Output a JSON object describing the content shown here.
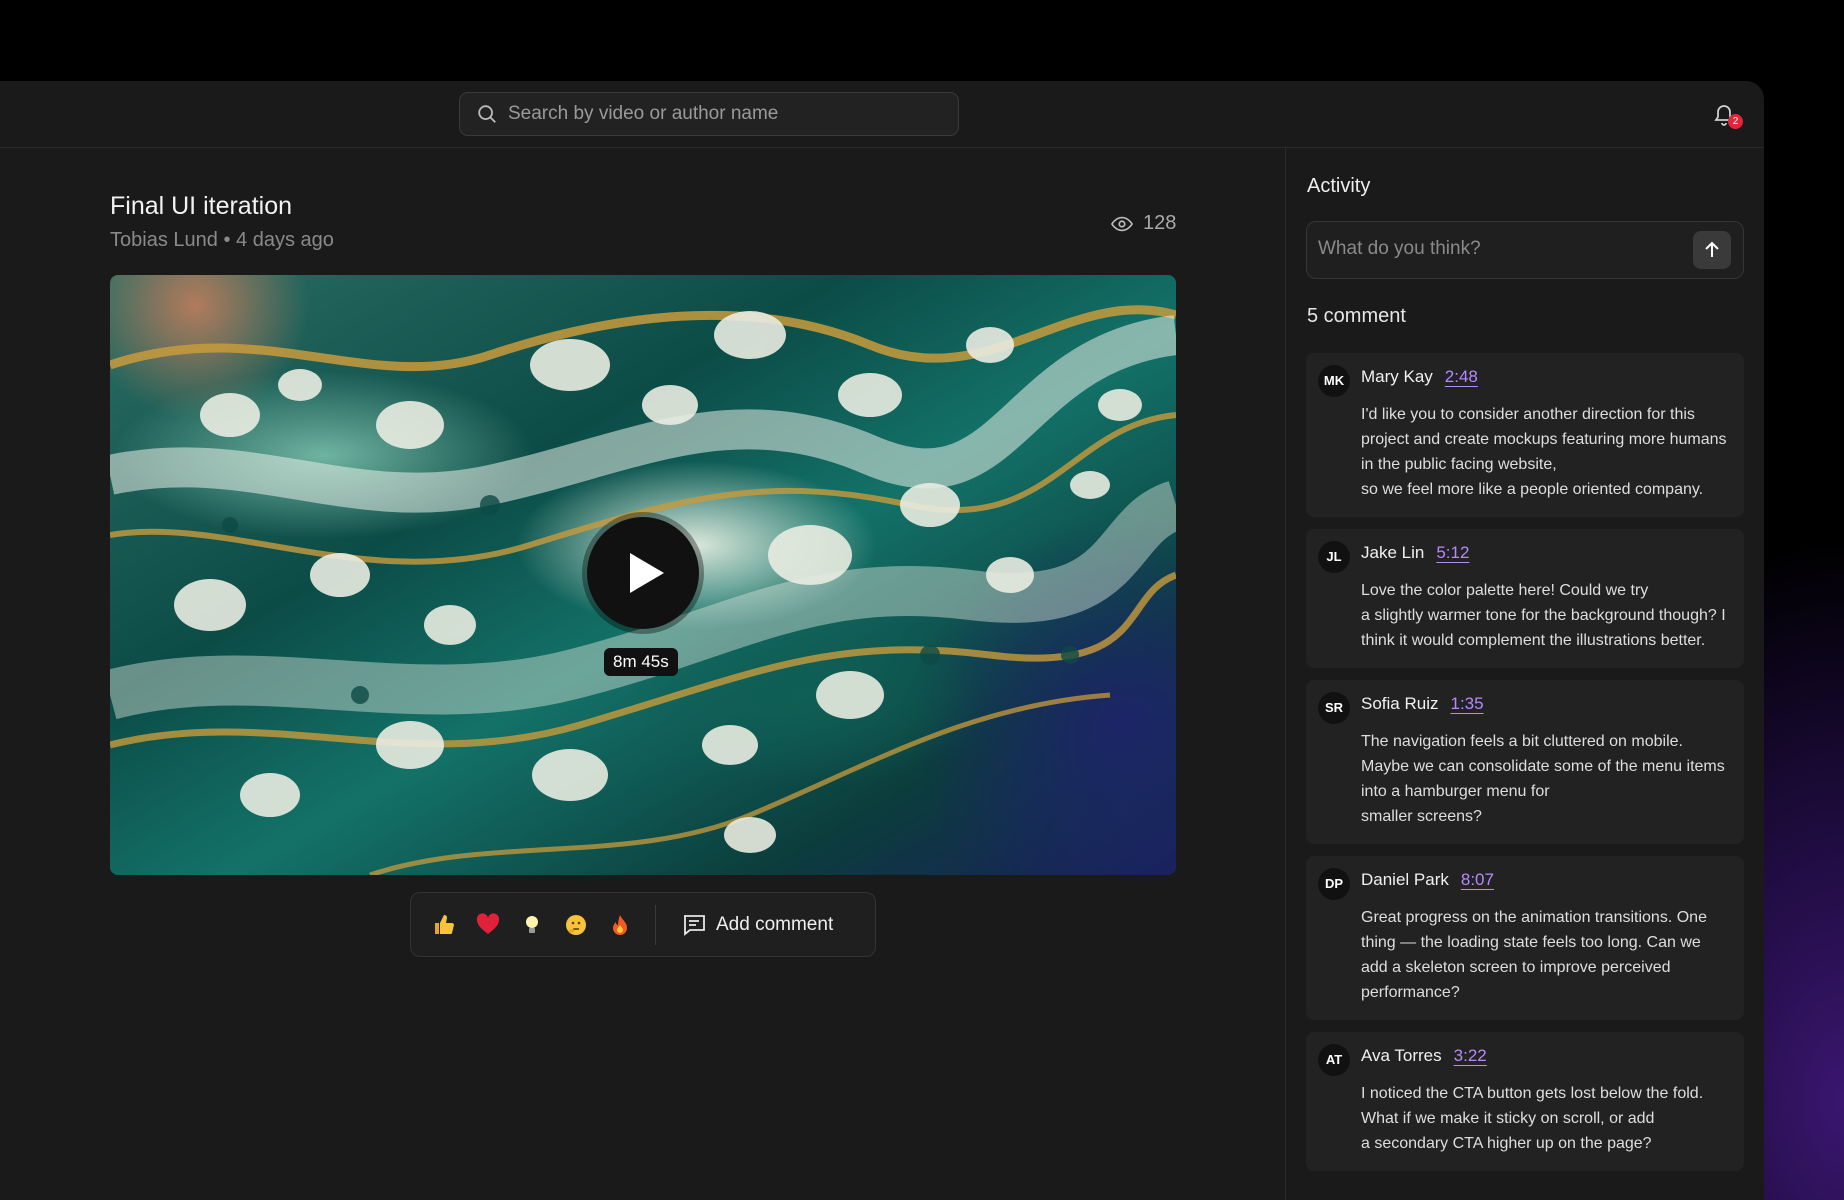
{
  "search": {
    "placeholder": "Search by video or author name"
  },
  "notifications": {
    "count": "2"
  },
  "video": {
    "title": "Final UI iteration",
    "author": "Tobias Lund",
    "separator": "•",
    "posted": "4 days ago",
    "views": "128",
    "duration": "8m 45s"
  },
  "reactions": {
    "items": [
      "thumbs-up-icon",
      "heart-icon",
      "lightbulb-icon",
      "thinking-face-icon",
      "fire-icon"
    ],
    "add_comment_label": "Add comment"
  },
  "activity": {
    "title": "Activity",
    "input_placeholder": "What do you think?",
    "count_label": "5 comment",
    "comments": [
      {
        "initials": "MK",
        "author": "Mary Kay",
        "timestamp": "2:48",
        "text": "I'd like you to consider another direction for this project and create mockups featuring more humans in the public facing website,\nso we feel more like a people oriented company."
      },
      {
        "initials": "JL",
        "author": "Jake Lin",
        "timestamp": "5:12",
        "text": "Love the color palette here! Could we try\na slightly warmer tone for the background though?  I think it would complement the illustrations better."
      },
      {
        "initials": "SR",
        "author": "Sofia Ruiz",
        "timestamp": "1:35",
        "text": "The navigation feels a bit cluttered on mobile. Maybe we can consolidate some of the menu items into a hamburger menu for\nsmaller screens?"
      },
      {
        "initials": "DP",
        "author": "Daniel Park",
        "timestamp": "8:07",
        "text": "Great progress on the animation transitions. One thing — the loading state feels too long. Can we add a skeleton screen to improve perceived performance?"
      },
      {
        "initials": "AT",
        "author": "Ava Torres",
        "timestamp": "3:22",
        "text": "I noticed the CTA button gets lost below the fold. What if we make it sticky on scroll, or add\n a secondary CTA higher up on the page?"
      }
    ]
  },
  "colors": {
    "accent_link": "#b689ff",
    "badge": "#e0263a",
    "app_bg": "#1a1a1a"
  }
}
